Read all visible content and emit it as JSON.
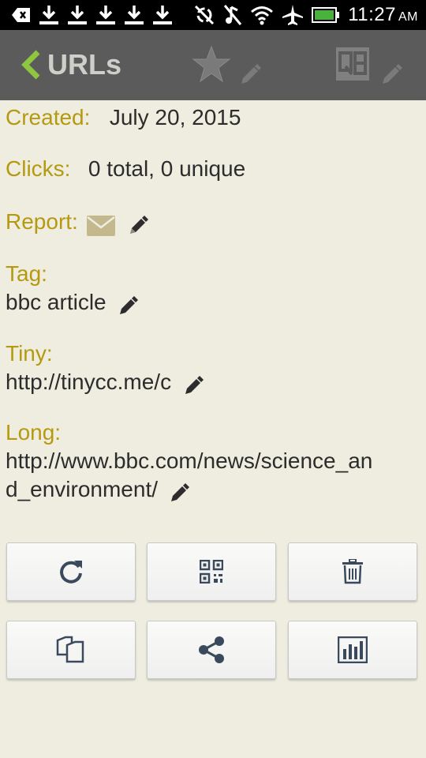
{
  "status_bar": {
    "time": "11:27",
    "ampm": "AM"
  },
  "action_bar": {
    "title": "URLs"
  },
  "details": {
    "created_label": "Created:",
    "created_value": "July 20, 2015",
    "clicks_label": "Clicks:",
    "clicks_value": "0 total, 0 unique",
    "report_label": "Report:",
    "tag_label": "Tag:",
    "tag_value": "bbc article",
    "tiny_label": "Tiny:",
    "tiny_value": "http://tinycc.me/c",
    "long_label": "Long:",
    "long_value_line1": "http://www.bbc.com/news/science_an",
    "long_value_line2": "d_environment/"
  },
  "colors": {
    "label": "#b59a10",
    "value": "#2c2c2c",
    "background": "#eeede0",
    "action_bar": "#5b5b5b",
    "back_chevron": "#8ec63f"
  },
  "buttons": [
    {
      "icon": "refresh-icon"
    },
    {
      "icon": "qr-code-icon"
    },
    {
      "icon": "trash-icon"
    },
    {
      "icon": "copy-icon"
    },
    {
      "icon": "share-icon"
    },
    {
      "icon": "stats-chart-icon"
    }
  ]
}
